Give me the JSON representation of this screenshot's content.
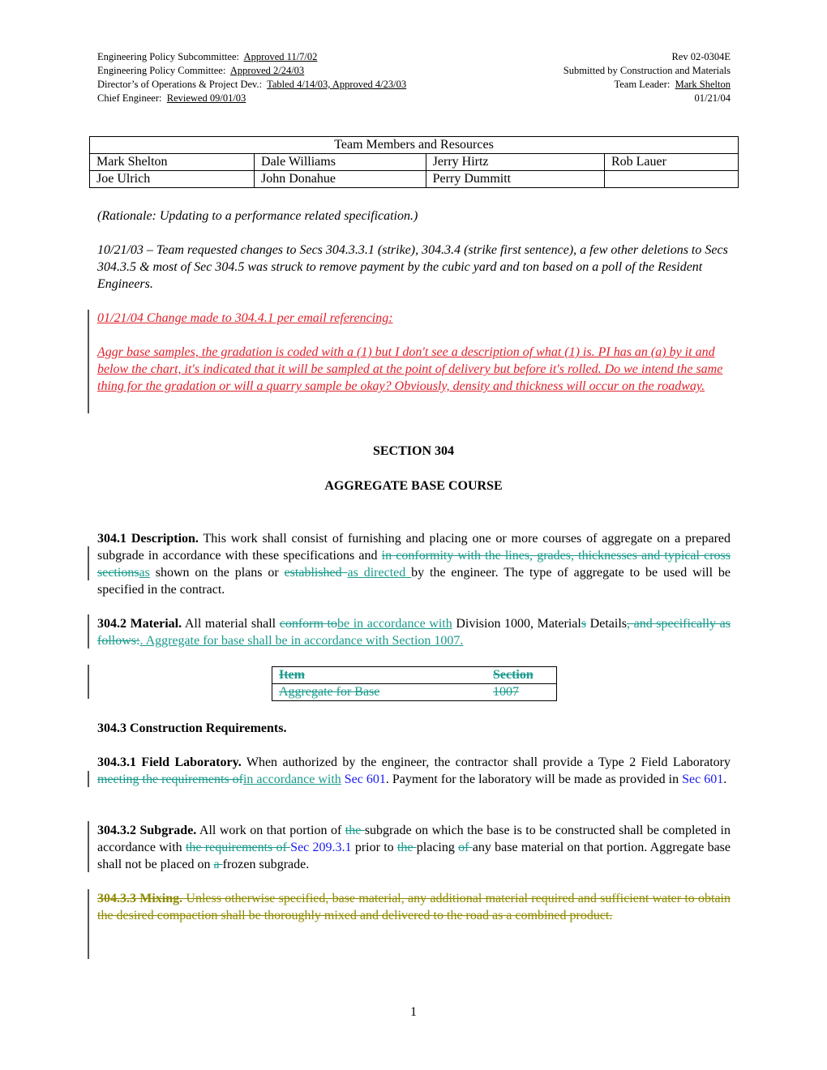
{
  "header": {
    "left": [
      {
        "label": "Engineering Policy Subcommittee:",
        "value": "Approved 11/7/02"
      },
      {
        "label": "Engineering Policy Committee:",
        "value": "Approved 2/24/03"
      },
      {
        "label": "Director’s of Operations & Project Dev.:",
        "value": "Tabled 4/14/03, Approved 4/23/03"
      },
      {
        "label": "Chief Engineer:",
        "value": "Reviewed 09/01/03"
      }
    ],
    "right": [
      {
        "label": "Rev 02-0304E",
        "value": ""
      },
      {
        "label": "Submitted by Construction and Materials",
        "value": ""
      },
      {
        "label": "Team Leader:",
        "value": "Mark Shelton"
      },
      {
        "label": "01/21/04",
        "value": ""
      }
    ]
  },
  "team_table": {
    "title": "Team Members and Resources",
    "rows": [
      [
        "Mark Shelton",
        "Dale Williams",
        "Jerry Hirtz",
        "Rob Lauer"
      ],
      [
        "Joe Ulrich",
        "John Donahue",
        "Perry Dummitt",
        ""
      ]
    ]
  },
  "rationale": "(Rationale:  Updating to a performance related specification.)",
  "note_1": "10/21/03 – Team requested changes to Secs 304.3.3.1 (strike), 304.3.4 (strike first sentence), a few other deletions to Secs 304.3.5 & most of Sec 304.5 was struck to remove payment by the cubic yard and ton based on a poll of the Resident Engineers.",
  "change_heading": "01/21/04 Change made to 304.4.1 per email referencing:",
  "change_email": " Aggr base samples, the gradation is coded with a (1) but I don't see a description of what (1) is.  PI has an (a) by it and below the chart, it's indicated that it will be sampled at the point of delivery but before it's rolled.  Do we intend the same thing for the gradation or will a quarry sample be okay?  Obviously, density and thickness will occur on the roadway.",
  "section_title": "SECTION 304",
  "section_subtitle": "AGGREGATE BASE COURSE",
  "s3041": {
    "heading": "304.1  Description.",
    "t1": "  This work shall consist of furnishing and placing one or more courses of aggregate on a prepared subgrade in accordance with these specifications and ",
    "del1": "in conformity with the lines, grades, thicknesses and typical cross sections",
    "ins1": "as",
    "t2": " shown on the plans or ",
    "del2": "established ",
    "ins2": "as directed ",
    "t3": "by the engineer. The type of aggregate to be used will be specified in the contract."
  },
  "s3042": {
    "heading": "304.2  Material.",
    "t1": "  All material shall ",
    "del1": "conform to",
    "ins1": "be in accordance with",
    "t2": " Division 1000, Material",
    "del2": "s",
    "t3": " Details",
    "del3": ", and specifically as follows:",
    "ins2": ".  Aggregate for base shall be in accordance with Section 1007."
  },
  "material_table": {
    "headers": [
      "Item",
      "Section"
    ],
    "rows": [
      [
        "Aggregate for Base",
        "1007"
      ]
    ]
  },
  "s3043": {
    "heading": "304.3  Construction Requirements."
  },
  "s30431": {
    "heading": "304.3.1  Field Laboratory.",
    "t1": "  When authorized by the engineer, the contractor shall provide a Type 2 Field Laboratory ",
    "del1": "meeting the requirements of",
    "ins1": "in accordance with",
    "t2": " ",
    "ref1": "Sec 601",
    "t3": ".  Payment for the laboratory will be made as provided in ",
    "ref2": "Sec 601",
    "t4": "."
  },
  "s30432": {
    "heading": "304.3.2  Subgrade.",
    "t1": "  All work on that portion of ",
    "del1": "the ",
    "t2": "subgrade on which the base is to be constructed shall be completed in accordance with ",
    "del2": "the requirements of ",
    "ref1": "Sec 209.3.1",
    "t3": " prior to ",
    "del3": "the ",
    "t4": "placing ",
    "del4": "of ",
    "t5": "any base material on that portion.  Aggregate base shall not be placed on ",
    "del5": "a ",
    "t6": "frozen subgrade."
  },
  "s30433": {
    "heading": "304.3.3  Mixing.",
    "text": "  Unless otherwise specified, base material, any additional material required and sufficient water to obtain the desired compaction shall be thoroughly mixed and delivered to the road as a combined product."
  },
  "page_number": "1",
  "colors": {
    "revision_red": "#e0202a",
    "track_change_teal": "#1a9a8c",
    "reference_blue": "#1a1aee",
    "deleted_olive": "#8e8a00"
  }
}
